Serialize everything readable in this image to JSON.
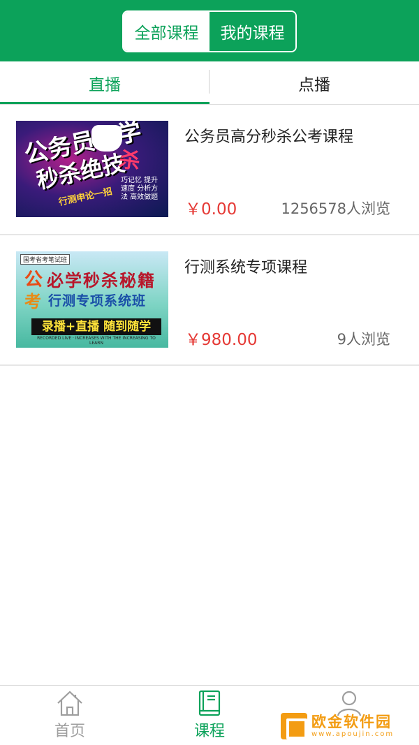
{
  "header": {
    "segments": [
      "全部课程",
      "我的课程"
    ],
    "active_segment": 0,
    "accent_color": "#0ca25a"
  },
  "subtabs": {
    "items": [
      "直播",
      "点播"
    ],
    "active": 0
  },
  "courses": [
    {
      "title": "公务员高分秒杀公考课程",
      "price": "￥0.00",
      "views": "1256578人浏览",
      "thumb_text": {
        "line1": "公务员",
        "line2": "必学",
        "line3": "秒杀绝技",
        "line4": "杀",
        "line5": "行测申论一招",
        "line6": "巧记忆 提升速度 分析方法 高效做题"
      }
    },
    {
      "title": "行测系统专项课程",
      "price": "￥980.00",
      "views": "9人浏览",
      "thumb_text": {
        "tag": "国考省考笔试班",
        "gong": "公",
        "kao": "考",
        "line1": "必学秒杀秘籍",
        "line2": "行测专项系统班",
        "banner": "录播+直播 随到随学",
        "small": "RECORDED LIVE · INCREASES WITH THE INCREASING TO LEARN"
      }
    }
  ],
  "bottom_nav": {
    "items": [
      {
        "label": "首页",
        "icon": "home-icon"
      },
      {
        "label": "课程",
        "icon": "book-icon"
      },
      {
        "label": "",
        "icon": "user-icon"
      }
    ],
    "active": 1
  },
  "watermark": {
    "main": "欧金软件园",
    "sub": "www.apoujin.com"
  },
  "colors": {
    "accent": "#0ca25a",
    "price": "#e53935",
    "inactive_nav": "#9e9e9e"
  }
}
